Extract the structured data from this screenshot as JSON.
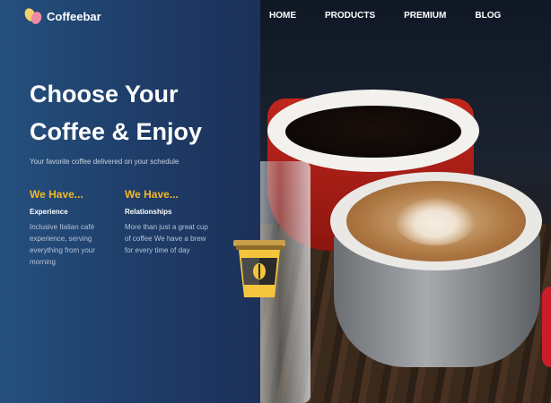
{
  "brand": {
    "name": "Coffeebar",
    "logo_icon": "coffee-beans-icon"
  },
  "nav": {
    "items": [
      "HOME",
      "PRODUCTS",
      "PREMIUM",
      "BLOG"
    ]
  },
  "hero": {
    "headline_line1": "Choose Your",
    "headline_line2": "Coffee & Enjoy",
    "subline": "Your favorite coffee delivered on your schedule"
  },
  "features": [
    {
      "title": "We Have...",
      "label": "Experience",
      "text": "Inclusive Italian café experience, serving everything from your morning"
    },
    {
      "title": "We Have...",
      "label": "Relationships",
      "text": "More than just a great cup of coffee We have a brew for every time of day"
    }
  ],
  "colors": {
    "accent": "#f4b72a",
    "panel": "#1f3e6a",
    "nav_text": "#ffffff"
  },
  "decor": {
    "cup_icon": "takeaway-coffee-cup-icon",
    "photo": "coffee-cups-photo"
  }
}
